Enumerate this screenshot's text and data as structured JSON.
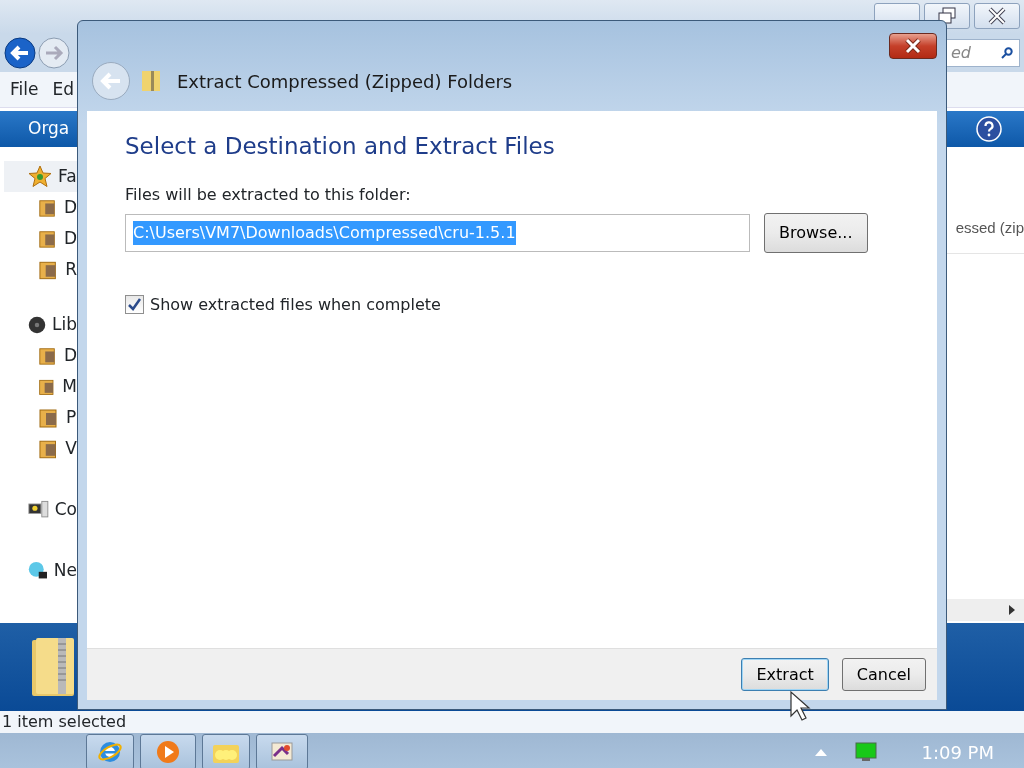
{
  "explorer": {
    "search": {
      "placeholder": "ed"
    },
    "menu": [
      "File",
      "Ed"
    ],
    "toolbar": {
      "organize": "Orga"
    },
    "nav": [
      {
        "label": "Fa",
        "kind": "favorites",
        "children": [
          {
            "label": "D"
          },
          {
            "label": "D"
          },
          {
            "label": "R"
          }
        ]
      },
      {
        "label": "Lib",
        "kind": "libraries",
        "children": [
          {
            "label": "D"
          },
          {
            "label": "M"
          },
          {
            "label": "P"
          },
          {
            "label": "V"
          }
        ]
      },
      {
        "label": "Co",
        "kind": "computer"
      },
      {
        "label": "Ne",
        "kind": "network"
      }
    ],
    "column_header": "essed (zip",
    "status": "1 item selected"
  },
  "dialog": {
    "title": "Extract Compressed (Zipped) Folders",
    "heading": "Select a Destination and Extract Files",
    "field_label": "Files will be extracted to this folder:",
    "path": "C:\\Users\\VM7\\Downloads\\Compressed\\cru-1.5.1",
    "browse": "Browse...",
    "show_files": {
      "label": "Show extracted files when complete",
      "checked": true
    },
    "buttons": [
      {
        "label": "Extract",
        "default": true
      },
      {
        "label": "Cancel",
        "default": false
      }
    ]
  },
  "taskbar": {
    "clock": "1:09 PM"
  }
}
